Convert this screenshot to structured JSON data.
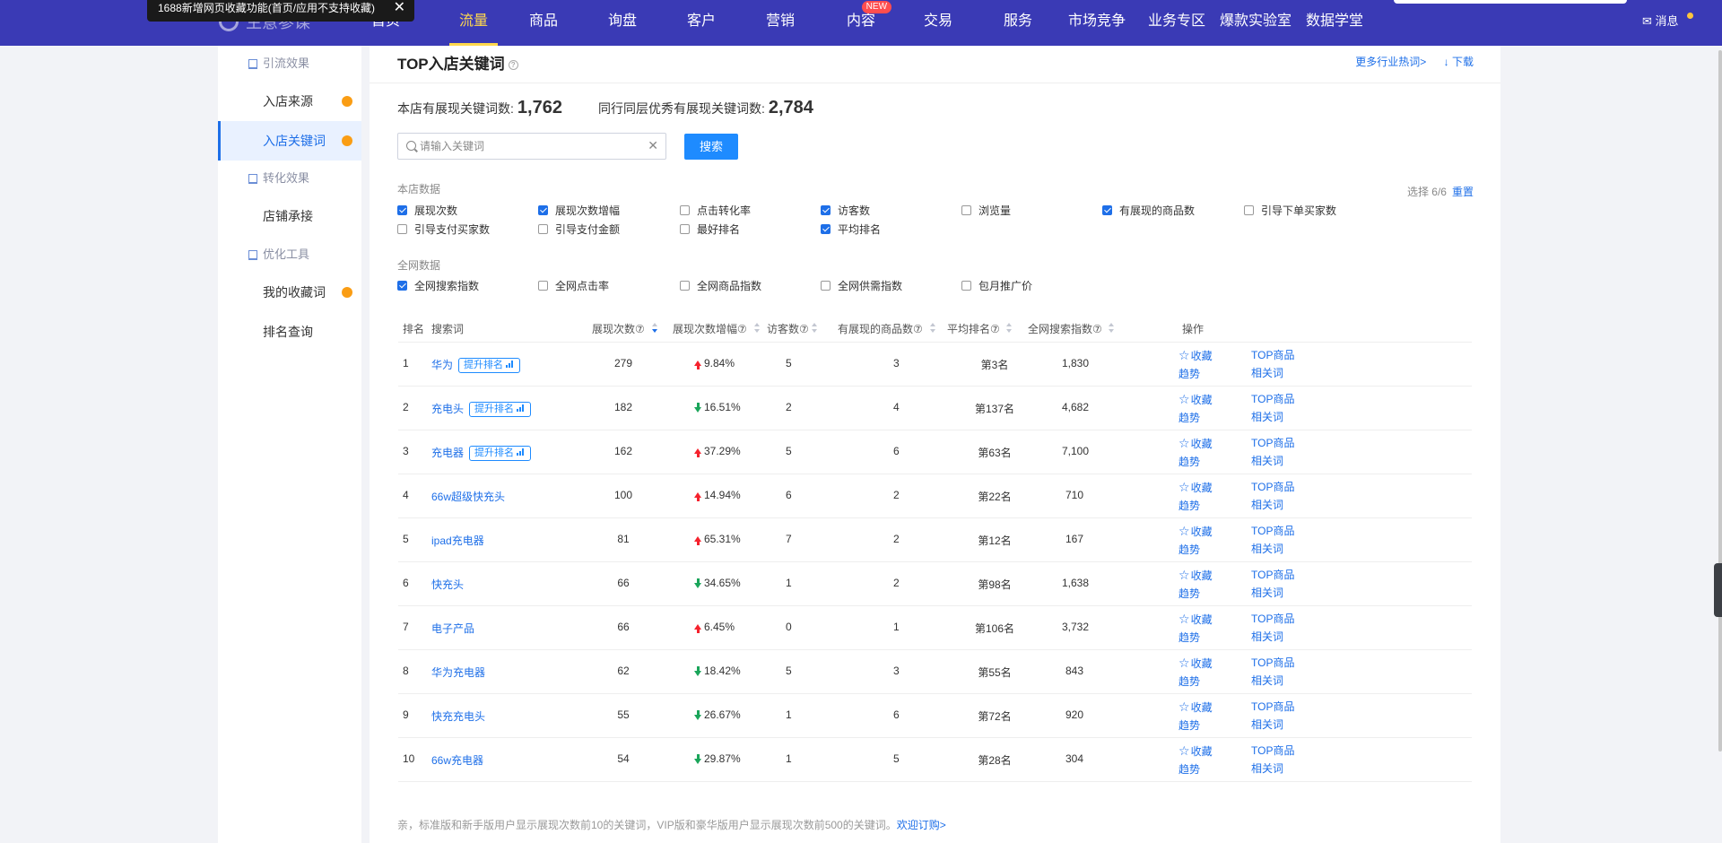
{
  "tooltip": {
    "text": "1688新增网页收藏功能(首页/应用不支持收藏)",
    "close": "✕"
  },
  "nav": {
    "brand": "生意参谋",
    "items": [
      "首页",
      "流量",
      "商品",
      "询盘",
      "客户",
      "营销",
      "内容",
      "交易",
      "服务",
      "市场竞争",
      "业务专区",
      "爆款实验室",
      "数据学堂"
    ],
    "active": "流量",
    "new_badge": "NEW",
    "messages": "消息"
  },
  "sidebar": {
    "groups": [
      "引流效果",
      "转化效果",
      "优化工具"
    ],
    "items": [
      "入店来源",
      "入店关键词",
      "店铺承接",
      "我的收藏词",
      "排名查询"
    ]
  },
  "header": {
    "title": "TOP入店关键词",
    "help": "?",
    "more_link": "更多行业热词>",
    "download": "↓ 下载"
  },
  "stats": {
    "shop_label": "本店有展现关键词数:",
    "shop_value": "1,762",
    "peer_label": "同行同层优秀有展现关键词数:",
    "peer_value": "2,784"
  },
  "search": {
    "placeholder": "请输入关键词",
    "clear": "✕",
    "button": "搜索"
  },
  "filters": {
    "shop_section": "本店数据",
    "web_section": "全网数据",
    "selected": "选择 6/6",
    "reset": "重置",
    "shop_options": [
      {
        "label": "展现次数",
        "checked": true
      },
      {
        "label": "展现次数增幅",
        "checked": true
      },
      {
        "label": "点击转化率",
        "checked": false
      },
      {
        "label": "访客数",
        "checked": true
      },
      {
        "label": "浏览量",
        "checked": false
      },
      {
        "label": "有展现的商品数",
        "checked": true
      },
      {
        "label": "引导下单买家数",
        "checked": false
      },
      {
        "label": "引导支付买家数",
        "checked": false
      },
      {
        "label": "引导支付金额",
        "checked": false
      },
      {
        "label": "最好排名",
        "checked": false
      },
      {
        "label": "平均排名",
        "checked": true
      }
    ],
    "web_options": [
      {
        "label": "全网搜索指数",
        "checked": true
      },
      {
        "label": "全网点击率",
        "checked": false
      },
      {
        "label": "全网商品指数",
        "checked": false
      },
      {
        "label": "全网供需指数",
        "checked": false
      },
      {
        "label": "包月推广价",
        "checked": false
      }
    ]
  },
  "table": {
    "columns": [
      "排名",
      "搜索词",
      "展现次数⑦",
      "展现次数增幅⑦",
      "访客数⑦",
      "有展现的商品数⑦",
      "平均排名⑦",
      "全网搜索指数⑦",
      "操作"
    ],
    "boost_label": "提升排名",
    "ops": {
      "favorite": "收藏",
      "top_goods": "TOP商品",
      "trend": "趋势",
      "related": "相关词"
    },
    "rows": [
      {
        "rank": "1",
        "keyword": "华为",
        "boost": true,
        "impressions": "279",
        "growth": "9.84%",
        "dir": "up",
        "visitors": "5",
        "goods": "3",
        "avg_rank": "第3名",
        "index": "1,830"
      },
      {
        "rank": "2",
        "keyword": "充电头",
        "boost": true,
        "impressions": "182",
        "growth": "16.51%",
        "dir": "down",
        "visitors": "2",
        "goods": "4",
        "avg_rank": "第137名",
        "index": "4,682"
      },
      {
        "rank": "3",
        "keyword": "充电器",
        "boost": true,
        "impressions": "162",
        "growth": "37.29%",
        "dir": "up",
        "visitors": "5",
        "goods": "6",
        "avg_rank": "第63名",
        "index": "7,100"
      },
      {
        "rank": "4",
        "keyword": "66w超级快充头",
        "boost": false,
        "impressions": "100",
        "growth": "14.94%",
        "dir": "up",
        "visitors": "6",
        "goods": "2",
        "avg_rank": "第22名",
        "index": "710"
      },
      {
        "rank": "5",
        "keyword": "ipad充电器",
        "boost": false,
        "impressions": "81",
        "growth": "65.31%",
        "dir": "up",
        "visitors": "7",
        "goods": "2",
        "avg_rank": "第12名",
        "index": "167"
      },
      {
        "rank": "6",
        "keyword": "快充头",
        "boost": false,
        "impressions": "66",
        "growth": "34.65%",
        "dir": "down",
        "visitors": "1",
        "goods": "2",
        "avg_rank": "第98名",
        "index": "1,638"
      },
      {
        "rank": "7",
        "keyword": "电子产品",
        "boost": false,
        "impressions": "66",
        "growth": "6.45%",
        "dir": "up",
        "visitors": "0",
        "goods": "1",
        "avg_rank": "第106名",
        "index": "3,732"
      },
      {
        "rank": "8",
        "keyword": "华为充电器",
        "boost": false,
        "impressions": "62",
        "growth": "18.42%",
        "dir": "down",
        "visitors": "5",
        "goods": "3",
        "avg_rank": "第55名",
        "index": "843"
      },
      {
        "rank": "9",
        "keyword": "快充充电头",
        "boost": false,
        "impressions": "55",
        "growth": "26.67%",
        "dir": "down",
        "visitors": "1",
        "goods": "6",
        "avg_rank": "第72名",
        "index": "920"
      },
      {
        "rank": "10",
        "keyword": "66w充电器",
        "boost": false,
        "impressions": "54",
        "growth": "29.87%",
        "dir": "down",
        "visitors": "1",
        "goods": "5",
        "avg_rank": "第28名",
        "index": "304"
      }
    ]
  },
  "footnote": {
    "text": "亲，标准版和新手版用户显示展现次数前10的关键词，VIP版和豪华版用户显示展现次数前500的关键词。",
    "link": "欢迎订购>"
  },
  "colors": {
    "nav_bg": "#3a3ab5",
    "accent": "#1e6fe8",
    "active_nav": "#ffd84d",
    "up": "#f5222d",
    "down": "#1aa55a",
    "badge": "#fa9d14"
  }
}
